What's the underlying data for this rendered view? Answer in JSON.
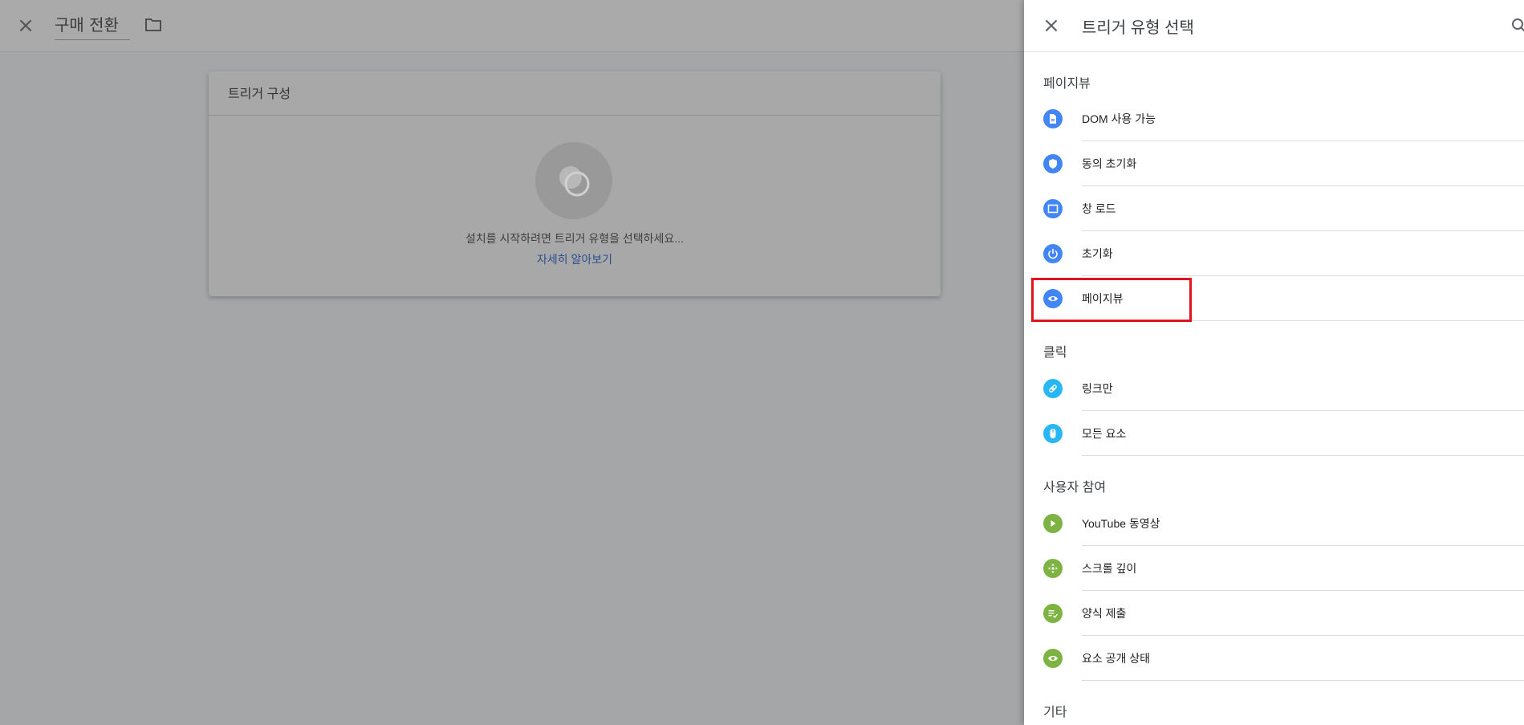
{
  "background": {
    "title": "구매 전환",
    "card_title": "트리거 구성",
    "card_message": "설치를 시작하려면 트리거 유형을 선택하세요...",
    "card_link": "자세히 알아보기"
  },
  "panel": {
    "title": "트리거 유형 선택",
    "sections": [
      {
        "title": "페이지뷰",
        "items": [
          {
            "label": "DOM 사용 가능",
            "icon": "document-icon",
            "color": "#4285f4"
          },
          {
            "label": "동의 초기화",
            "icon": "shield-icon",
            "color": "#4285f4"
          },
          {
            "label": "창 로드",
            "icon": "window-icon",
            "color": "#4285f4"
          },
          {
            "label": "초기화",
            "icon": "power-icon",
            "color": "#4285f4"
          },
          {
            "label": "페이지뷰",
            "icon": "eye-icon",
            "color": "#4285f4"
          }
        ]
      },
      {
        "title": "클릭",
        "items": [
          {
            "label": "링크만",
            "icon": "link-icon",
            "color": "#29b6f6"
          },
          {
            "label": "모든 요소",
            "icon": "mouse-icon",
            "color": "#29b6f6"
          }
        ]
      },
      {
        "title": "사용자 참여",
        "items": [
          {
            "label": "YouTube 동영상",
            "icon": "play-icon",
            "color": "#7cb342"
          },
          {
            "label": "스크롤 깊이",
            "icon": "move-icon",
            "color": "#7cb342"
          },
          {
            "label": "양식 제출",
            "icon": "form-icon",
            "color": "#7cb342"
          },
          {
            "label": "요소 공개 상태",
            "icon": "eye-icon",
            "color": "#7cb342"
          }
        ]
      },
      {
        "title": "기타",
        "items": []
      }
    ]
  },
  "highlight_color": "#e0141e"
}
